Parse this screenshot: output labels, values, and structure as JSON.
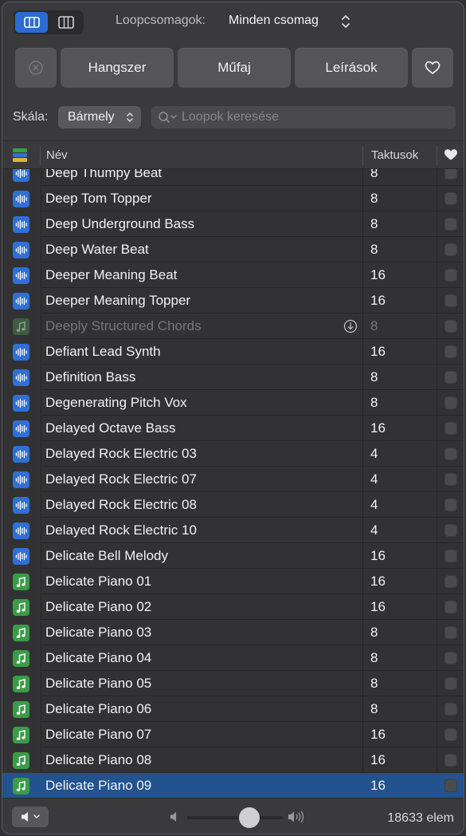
{
  "toolbar": {
    "loop_packs_label": "Loopcsomagok:",
    "loop_packs_value": "Minden csomag",
    "view_icons": [
      "list-view-icon",
      "column-view-icon"
    ]
  },
  "filters": {
    "clear_icon": "clear-x-icon",
    "instrument": "Hangszer",
    "genre": "Műfaj",
    "descriptors": "Leírások",
    "favorites_icon": "heart-icon"
  },
  "scale": {
    "label": "Skála:",
    "value": "Bármely"
  },
  "search": {
    "placeholder": "Loopok keresése",
    "value": ""
  },
  "table": {
    "columns": {
      "type_icon": "loop-type-icon",
      "name": "Név",
      "bars": "Taktusok",
      "favorite_icon": "heart-icon"
    },
    "rows": [
      {
        "name": "Deep Thumpy Beat",
        "bars": "8",
        "type": "audio"
      },
      {
        "name": "Deep Tom Topper",
        "bars": "8",
        "type": "audio"
      },
      {
        "name": "Deep Underground Bass",
        "bars": "8",
        "type": "audio"
      },
      {
        "name": "Deep Water Beat",
        "bars": "8",
        "type": "audio"
      },
      {
        "name": "Deeper Meaning Beat",
        "bars": "16",
        "type": "audio"
      },
      {
        "name": "Deeper Meaning Topper",
        "bars": "16",
        "type": "audio"
      },
      {
        "name": "Deeply Structured Chords",
        "bars": "8",
        "type": "midi",
        "disabled": true,
        "downloadable": true
      },
      {
        "name": "Defiant Lead Synth",
        "bars": "16",
        "type": "audio"
      },
      {
        "name": "Definition Bass",
        "bars": "8",
        "type": "audio"
      },
      {
        "name": "Degenerating Pitch Vox",
        "bars": "8",
        "type": "audio"
      },
      {
        "name": "Delayed Octave Bass",
        "bars": "16",
        "type": "audio"
      },
      {
        "name": "Delayed Rock Electric 03",
        "bars": "4",
        "type": "audio"
      },
      {
        "name": "Delayed Rock Electric 07",
        "bars": "4",
        "type": "audio"
      },
      {
        "name": "Delayed Rock Electric 08",
        "bars": "4",
        "type": "audio"
      },
      {
        "name": "Delayed Rock Electric 10",
        "bars": "4",
        "type": "audio"
      },
      {
        "name": "Delicate Bell Melody",
        "bars": "16",
        "type": "audio"
      },
      {
        "name": "Delicate Piano 01",
        "bars": "16",
        "type": "midi"
      },
      {
        "name": "Delicate Piano 02",
        "bars": "16",
        "type": "midi"
      },
      {
        "name": "Delicate Piano 03",
        "bars": "8",
        "type": "midi"
      },
      {
        "name": "Delicate Piano 04",
        "bars": "8",
        "type": "midi"
      },
      {
        "name": "Delicate Piano 05",
        "bars": "8",
        "type": "midi"
      },
      {
        "name": "Delicate Piano 06",
        "bars": "8",
        "type": "midi"
      },
      {
        "name": "Delicate Piano 07",
        "bars": "16",
        "type": "midi"
      },
      {
        "name": "Delicate Piano 08",
        "bars": "16",
        "type": "midi"
      },
      {
        "name": "Delicate Piano 09",
        "bars": "16",
        "type": "midi",
        "selected": true
      }
    ]
  },
  "footer": {
    "speaker_icon": "speaker-icon",
    "volume_low_icon": "volume-low-icon",
    "volume_high_icon": "volume-high-icon",
    "volume_level": 0.65,
    "item_count": "18633 elem"
  },
  "colors": {
    "accent": "#2c6bd4",
    "selection": "#22538f",
    "audio_icon": "#2f6fd6",
    "midi_icon": "#3a9c47"
  }
}
